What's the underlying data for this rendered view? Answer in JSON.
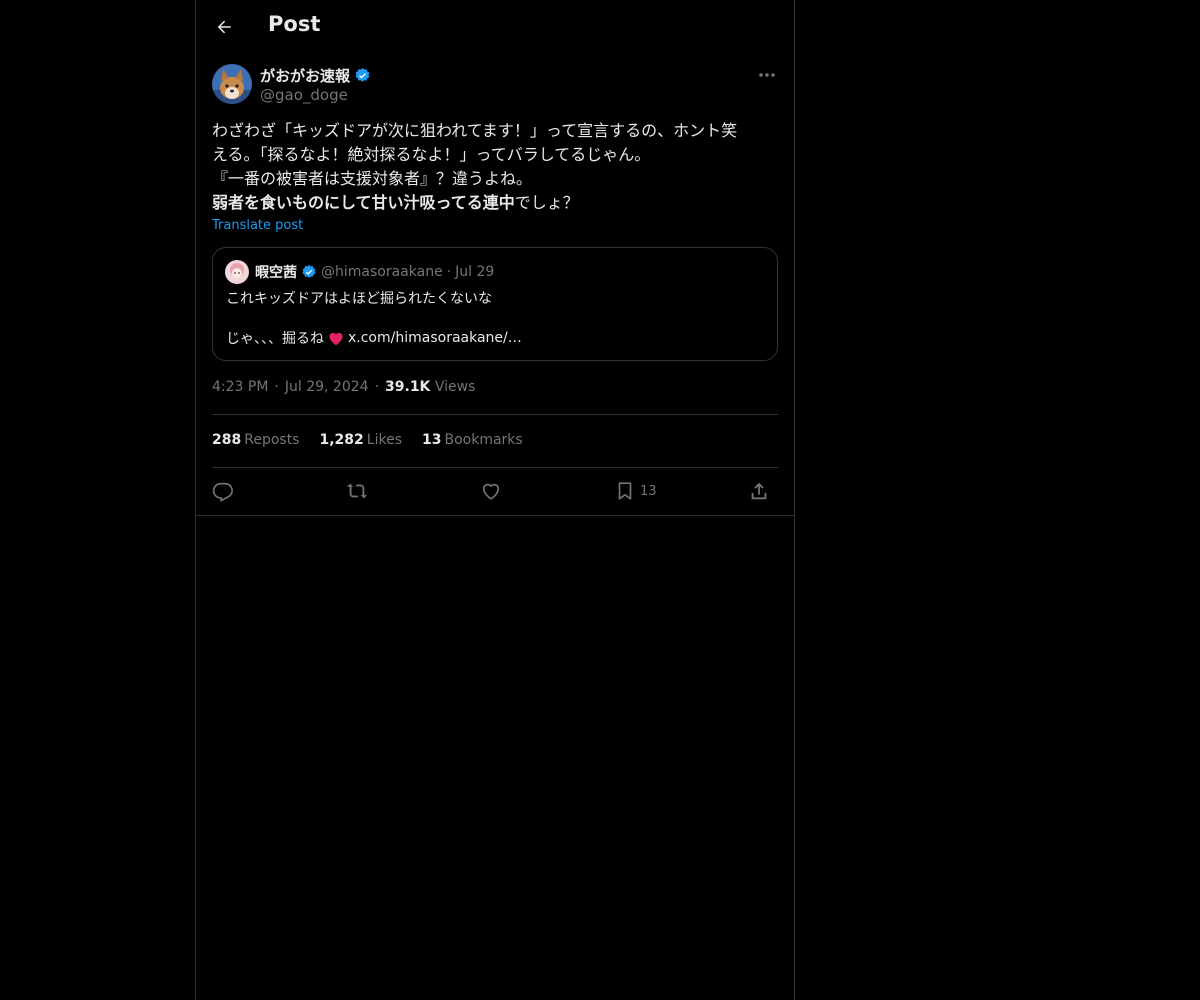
{
  "header": {
    "title": "Post"
  },
  "author": {
    "display_name": "がおがお速報",
    "handle": "@gao_doge"
  },
  "post": {
    "line1": "わざわざ「キッズドアが次に狙われてます！」って宣言するの、ホント笑",
    "line2": "える。「探るなよ！絶対探るなよ！」ってバラしてるじゃん。",
    "line3": "『一番の被害者は支援対象者』？違うよね。",
    "line4_bold": "弱者を食いものにして甘い汁吸ってる連中",
    "line4_tail": "でしょ？",
    "translate_label": "Translate post"
  },
  "quote": {
    "display_name": "暇空茜",
    "handle": "@himasoraakane",
    "separator": "·",
    "date": "Jul 29",
    "line1": "これキッズドアはよほど掘られたくないな",
    "line2_prefix": "じゃ、、、掘るね",
    "line2_link": "x.com/himasoraakane/…"
  },
  "meta": {
    "time": "4:23 PM",
    "separator": "·",
    "date": "Jul 29, 2024",
    "views_count": "39.1K",
    "views_label": "Views"
  },
  "stats": {
    "reposts_count": "288",
    "reposts_label": "Reposts",
    "likes_count": "1,282",
    "likes_label": "Likes",
    "bookmarks_count": "13",
    "bookmarks_label": "Bookmarks"
  },
  "actions": {
    "bookmark_count": "13"
  },
  "colors": {
    "background": "#000000",
    "text": "#e7e9ea",
    "muted": "#71767b",
    "accent": "#1d9bf0",
    "border": "#2f3336"
  },
  "icons": [
    "back-arrow-icon",
    "verified-badge-icon",
    "more-icon",
    "reply-icon",
    "repost-icon",
    "like-icon",
    "bookmark-icon",
    "share-icon",
    "heart-emoji-icon"
  ]
}
